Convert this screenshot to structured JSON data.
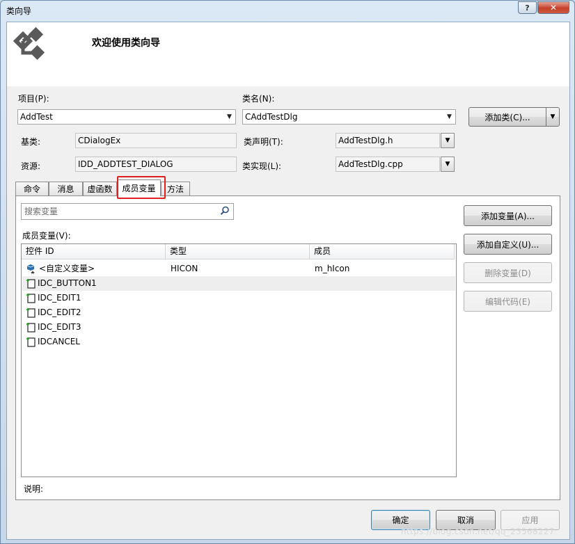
{
  "window": {
    "title": "类向导",
    "help_glyph": "?",
    "close_glyph": "✕"
  },
  "banner": {
    "title": "欢迎使用类向导",
    "logo_icon": "class-wizard-logo"
  },
  "fields": {
    "project_label": "项目(P):",
    "project_value": "AddTest",
    "classname_label": "类名(N):",
    "classname_value": "CAddTestDlg",
    "add_class_button": "添加类(C)...",
    "base_label": "基类:",
    "base_value": "CDialogEx",
    "decl_label": "类声明(T):",
    "decl_value": "AddTestDlg.h",
    "resource_label": "资源:",
    "resource_value": "IDD_ADDTEST_DIALOG",
    "impl_label": "类实现(L):",
    "impl_value": "AddTestDlg.cpp"
  },
  "tabs": [
    "命令",
    "消息",
    "虚函数",
    "成员变量",
    "方法"
  ],
  "active_tab": "成员变量",
  "members": {
    "search_placeholder": "搜索变量",
    "list_label": "成员变量(V):",
    "columns": [
      "控件 ID",
      "类型",
      "成员"
    ],
    "rows": [
      {
        "id": "<自定义变量>",
        "type": "HICON",
        "member": "m_hIcon",
        "icon": "custom-variable-icon"
      },
      {
        "id": "IDC_BUTTON1",
        "type": "",
        "member": "",
        "icon": "control-icon"
      },
      {
        "id": "IDC_EDIT1",
        "type": "",
        "member": "",
        "icon": "control-icon"
      },
      {
        "id": "IDC_EDIT2",
        "type": "",
        "member": "",
        "icon": "control-icon"
      },
      {
        "id": "IDC_EDIT3",
        "type": "",
        "member": "",
        "icon": "control-icon"
      },
      {
        "id": "IDCANCEL",
        "type": "",
        "member": "",
        "icon": "control-icon"
      }
    ],
    "selected_row": "IDC_BUTTON1",
    "buttons": {
      "add_variable": "添加变量(A)...",
      "add_custom": "添加自定义(U)...",
      "delete_variable": "删除变量(D)",
      "edit_code": "编辑代码(E)"
    }
  },
  "description_label": "说明:",
  "footer": {
    "ok": "确定",
    "cancel": "取消",
    "apply": "应用"
  },
  "watermark": "https://blog.csdn.net/qq_23568227",
  "colors": {
    "highlight_box": "#e02020",
    "titlebar": "#c9d9ea",
    "close_button": "#c4402b"
  }
}
